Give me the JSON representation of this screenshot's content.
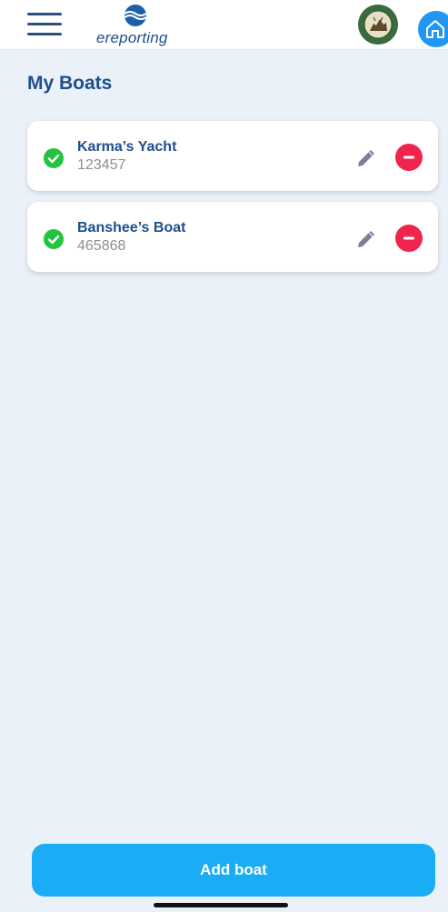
{
  "header": {
    "app_name": "ereporting",
    "seal_icon": "louisiana-wildlife-fisheries-seal",
    "home_icon": "home-icon",
    "menu_icon": "hamburger-menu-icon"
  },
  "page": {
    "title": "My Boats"
  },
  "boats": [
    {
      "name": "Karma’s Yacht",
      "registration": "123457",
      "status_icon": "check-circle-icon",
      "edit_icon": "pencil-icon",
      "delete_icon": "minus-circle-icon"
    },
    {
      "name": "Banshee’s Boat",
      "registration": "465868",
      "status_icon": "check-circle-icon",
      "edit_icon": "pencil-icon",
      "delete_icon": "minus-circle-icon"
    }
  ],
  "actions": {
    "add_boat_label": "Add boat"
  },
  "colors": {
    "primary": "#1f4e8c",
    "accent": "#1aacf5",
    "success": "#22c33e",
    "danger": "#f0254f",
    "edit_icon": "#7c8097",
    "background": "#eaf1f9"
  }
}
